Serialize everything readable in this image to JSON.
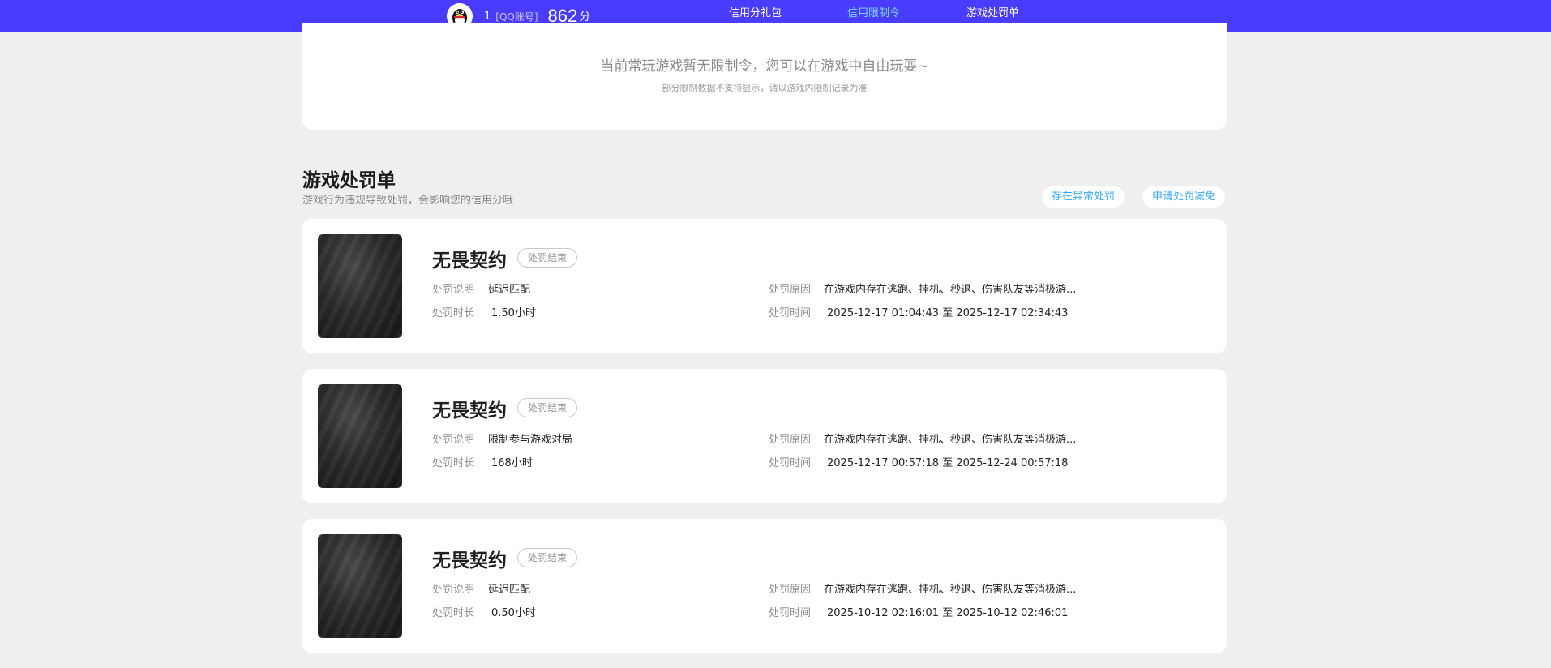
{
  "header": {
    "user_id": "1",
    "account_type": "[QQ账号]",
    "score": "862",
    "score_unit": "分",
    "nav": [
      {
        "label": "信用分礼包",
        "active": false
      },
      {
        "label": "信用限制令",
        "active": true
      },
      {
        "label": "游戏处罚单",
        "active": false
      }
    ]
  },
  "restriction_notice": {
    "message": "当前常玩游戏暂无限制令，您可以在游戏中自由玩耍~",
    "note": "部分限制数据不支持显示，请以游戏内限制记录为准"
  },
  "punishment_section": {
    "title": "游戏处罚单",
    "subtitle": "游戏行为违规导致处罚，会影响您的信用分哦",
    "actions": {
      "abnormal": "存在异常处罚",
      "appeal": "申请处罚减免"
    },
    "labels": {
      "description": "处罚说明",
      "duration": "处罚时长",
      "reason": "处罚原因",
      "time": "处罚时间"
    },
    "records": [
      {
        "game": "无畏契约",
        "status": "处罚结束",
        "description": "延迟匹配",
        "duration": "1.50小时",
        "reason": "在游戏内存在逃跑、挂机、秒退、伤害队友等消极游...",
        "time_range": "2025-12-17 01:04:43 至 2025-12-17 02:34:43"
      },
      {
        "game": "无畏契约",
        "status": "处罚结束",
        "description": "限制参与游戏对局",
        "duration": "168小时",
        "reason": "在游戏内存在逃跑、挂机、秒退、伤害队友等消极游...",
        "time_range": "2025-12-17 00:57:18 至 2025-12-24 00:57:18"
      },
      {
        "game": "无畏契约",
        "status": "处罚结束",
        "description": "延迟匹配",
        "duration": "0.50小时",
        "reason": "在游戏内存在逃跑、挂机、秒退、伤害队友等消极游...",
        "time_range": "2025-10-12 02:16:01 至 2025-10-12 02:46:01"
      }
    ]
  },
  "colors": {
    "header_bg": "#4a3cff",
    "active_nav": "#7ed8ff",
    "page_bg": "#efefef",
    "pill_text": "#3aa9ff"
  },
  "icons": {
    "avatar": "qq-penguin-icon"
  }
}
